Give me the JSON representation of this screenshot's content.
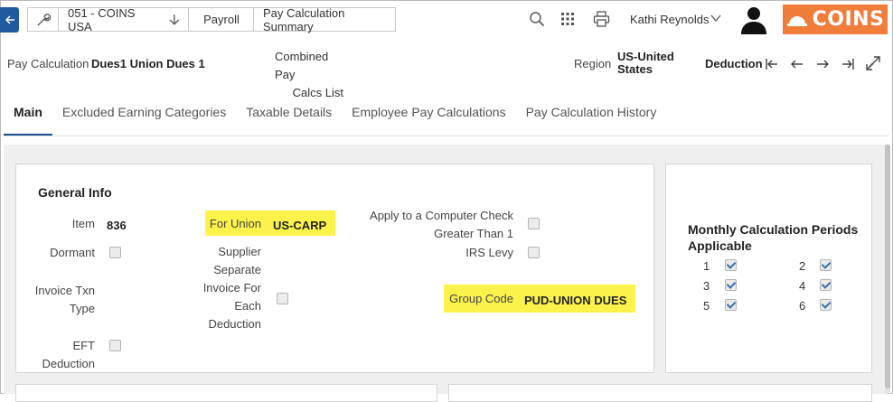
{
  "breadcrumbs": {
    "company": "051 - COINS USA",
    "module": "Payroll",
    "page": "Pay Calculation Summary"
  },
  "user": {
    "name": "Kathi Reynolds"
  },
  "brand": {
    "logo_text": "COINS",
    "accent": "#f07d3a"
  },
  "record": {
    "pay_calc_label": "Pay Calculation",
    "pay_calc_value": "Dues1 Union Dues 1",
    "combined_line1": "Combined Pay",
    "combined_line2": "Calcs List",
    "region_label": "Region",
    "region_line1": "US-United",
    "region_line2": "States",
    "type_value": "Deduction"
  },
  "tabs": [
    {
      "label": "Main",
      "active": true
    },
    {
      "label": "Excluded Earning Categories"
    },
    {
      "label": "Taxable Details"
    },
    {
      "label": "Employee Pay Calculations"
    },
    {
      "label": "Pay Calculation History"
    }
  ],
  "general_info": {
    "title": "General Info",
    "item_label": "Item",
    "item_value": "836",
    "dormant_label": "Dormant",
    "invoice_txn_line1": "Invoice Txn",
    "invoice_txn_line2": "Type",
    "eft_label": "EFT Deduction",
    "for_union_label": "For Union",
    "for_union_value": "US-CARP",
    "supplier_lines": [
      "Supplier",
      "Separate",
      "Invoice For",
      "Each",
      "Deduction"
    ],
    "apply_line1": "Apply to a Computer Check",
    "apply_line2": "Greater Than 1",
    "irs_levy_label": "IRS Levy",
    "group_code_label": "Group Code",
    "group_code_value": "PUD-UNION DUES",
    "highlight_color": "#fbf24b"
  },
  "monthly": {
    "title_line1": "Monthly Calculation Periods",
    "title_line2": "Applicable",
    "periods": [
      {
        "num": "1",
        "checked": true
      },
      {
        "num": "2",
        "checked": true
      },
      {
        "num": "3",
        "checked": true
      },
      {
        "num": "4",
        "checked": true
      },
      {
        "num": "5",
        "checked": true
      },
      {
        "num": "6",
        "checked": true
      }
    ]
  }
}
